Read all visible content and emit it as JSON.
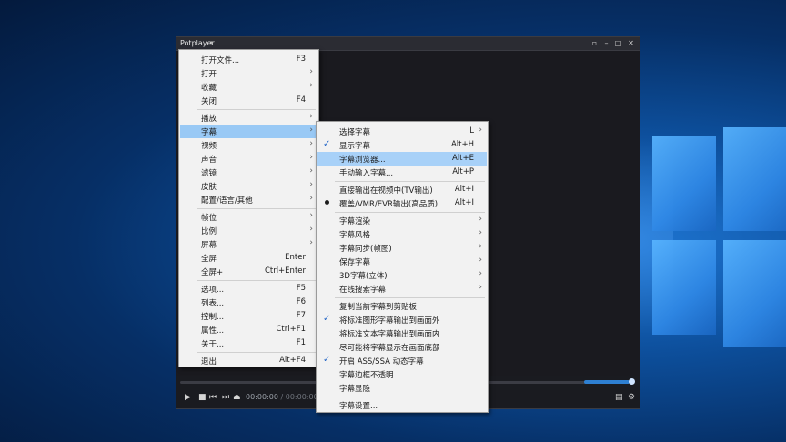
{
  "player": {
    "title": "Potplayer",
    "caret": "▾",
    "window_controls": [
      "pin-icon",
      "minimize-icon",
      "maximize-icon",
      "close-icon"
    ],
    "time_current": "00:00:00",
    "time_total": "00:00:00",
    "time_sep": "/"
  },
  "main_menu": {
    "open_file": {
      "label": "打开文件...",
      "shortcut": "F3"
    },
    "open": {
      "label": "打开"
    },
    "favorites": {
      "label": "收藏"
    },
    "close": {
      "label": "关闭",
      "shortcut": "F4"
    },
    "playback": {
      "label": "播放"
    },
    "subtitles": {
      "label": "字幕"
    },
    "video": {
      "label": "视频"
    },
    "audio": {
      "label": "声音"
    },
    "filters": {
      "label": "滤镜"
    },
    "skins": {
      "label": "皮肤"
    },
    "config": {
      "label": "配置/语言/其他"
    },
    "frame": {
      "label": "帧位"
    },
    "ratio": {
      "label": "比例"
    },
    "screen": {
      "label": "屏幕"
    },
    "fullscreen": {
      "label": "全屏",
      "shortcut": "Enter"
    },
    "fullscreen_plus": {
      "label": "全屏+",
      "shortcut": "Ctrl+Enter"
    },
    "options": {
      "label": "选项...",
      "shortcut": "F5"
    },
    "playlist": {
      "label": "列表...",
      "shortcut": "F6"
    },
    "control": {
      "label": "控制...",
      "shortcut": "F7"
    },
    "properties": {
      "label": "属性...",
      "shortcut": "Ctrl+F1"
    },
    "about": {
      "label": "关于...",
      "shortcut": "F1"
    },
    "exit": {
      "label": "退出",
      "shortcut": "Alt+F4"
    }
  },
  "sub_menu": {
    "select": {
      "label": "选择字幕",
      "shortcut": "L"
    },
    "show": {
      "label": "显示字幕",
      "shortcut": "Alt+H",
      "checked": true
    },
    "browser": {
      "label": "字幕浏览器...",
      "shortcut": "Alt+E"
    },
    "manual": {
      "label": "手动输入字幕...",
      "shortcut": "Alt+P"
    },
    "direct_out": {
      "label": "直接输出在视频中(TV输出)",
      "shortcut": "Alt+I"
    },
    "overlay": {
      "label": "覆盖/VMR/EVR输出(高品质)",
      "shortcut": "Alt+I",
      "selected": true
    },
    "render": {
      "label": "字幕渲染"
    },
    "style": {
      "label": "字幕风格"
    },
    "sync": {
      "label": "字幕同步(帧图)"
    },
    "save": {
      "label": "保存字幕"
    },
    "stereo": {
      "label": "3D字幕(立体)"
    },
    "online": {
      "label": "在线搜索字幕"
    },
    "copy": {
      "label": "复制当前字幕到剪贴板"
    },
    "img_outside": {
      "label": "将标准图形字幕输出到画面外",
      "checked": true
    },
    "text_inside": {
      "label": "将标准文本字幕输出到画面内"
    },
    "bottom": {
      "label": "尽可能将字幕显示在画面底部"
    },
    "ass": {
      "label": "开启 ASS/SSA 动态字幕",
      "checked": true
    },
    "opaque": {
      "label": "字幕边框不透明"
    },
    "hide": {
      "label": "字幕显隐"
    },
    "settings": {
      "label": "字幕设置..."
    }
  },
  "glyphs": {
    "arrow": "›",
    "check": "✓"
  },
  "colors": {
    "accent": "#2e7fd1",
    "highlight": "#99c9f5",
    "menu_bg": "#f2f2f2",
    "player_bg": "#1a1b20"
  }
}
